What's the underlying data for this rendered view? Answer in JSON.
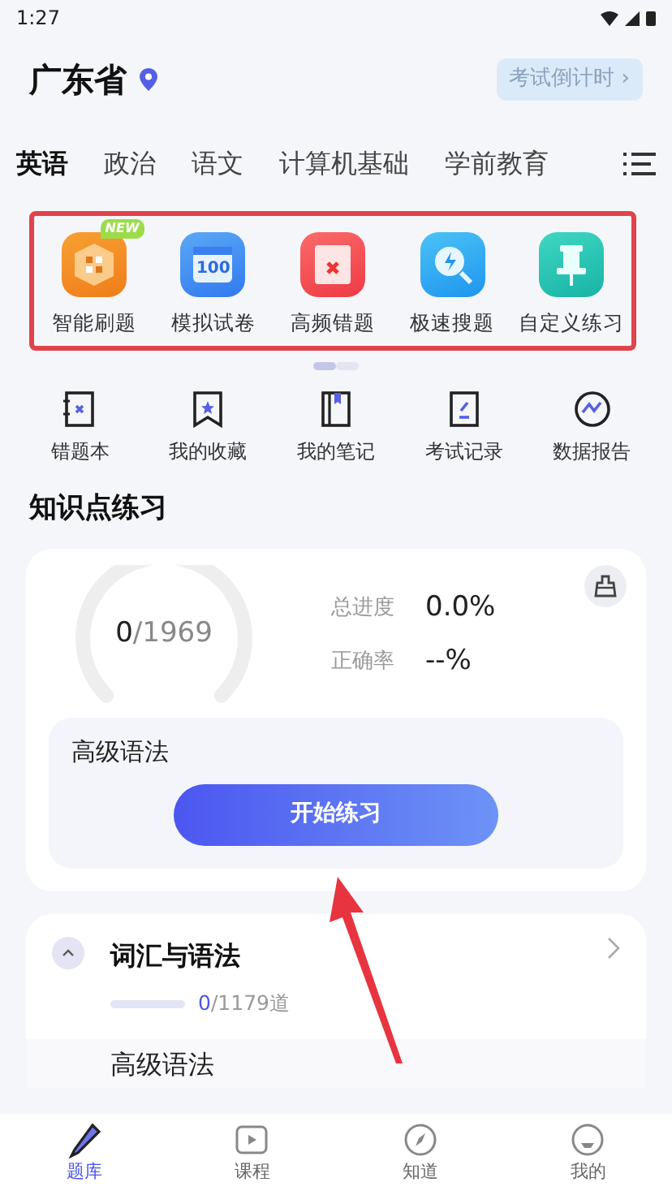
{
  "status_bar": {
    "time": "1:27"
  },
  "header": {
    "province": "广东省",
    "countdown_button": "考试倒计时 ›"
  },
  "subject_tabs": [
    {
      "label": "英语",
      "selected": true
    },
    {
      "label": "政治",
      "selected": false
    },
    {
      "label": "语文",
      "selected": false
    },
    {
      "label": "计算机基础",
      "selected": false
    },
    {
      "label": "学前教育",
      "selected": false
    }
  ],
  "feature_grid": [
    {
      "label": "智能刷题",
      "badge": "NEW"
    },
    {
      "label": "模拟试卷",
      "icon_text": "100"
    },
    {
      "label": "高频错题"
    },
    {
      "label": "极速搜题"
    },
    {
      "label": "自定义练习"
    }
  ],
  "pager": [
    {
      "selected": true
    },
    {
      "selected": false
    }
  ],
  "tools": [
    {
      "label": "错题本"
    },
    {
      "label": "我的收藏"
    },
    {
      "label": "我的笔记"
    },
    {
      "label": "考试记录"
    },
    {
      "label": "数据报告"
    }
  ],
  "section_title": "知识点练习",
  "progress_card": {
    "done": "0",
    "total": "/1969",
    "stats": [
      {
        "label": "总进度",
        "value": "0.0%"
      },
      {
        "label": "正确率",
        "value": "--%"
      }
    ],
    "current_topic": "高级语法",
    "start_button": "开始练习"
  },
  "topics": [
    {
      "title": "词汇与语法",
      "done": "0",
      "total": "/1179道",
      "expanded": true
    },
    {
      "title": "高级语法"
    }
  ],
  "bottom_nav": [
    {
      "label": "题库",
      "selected": true
    },
    {
      "label": "课程",
      "selected": false
    },
    {
      "label": "知道",
      "selected": false
    },
    {
      "label": "我的",
      "selected": false
    }
  ]
}
